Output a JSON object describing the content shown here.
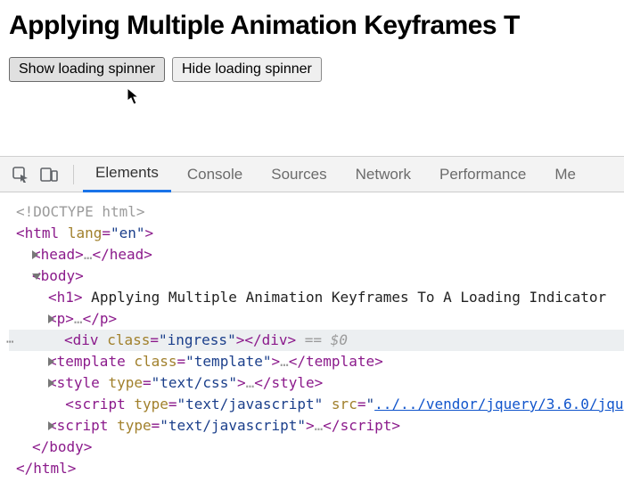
{
  "page": {
    "heading": "Applying Multiple Animation Keyframes T",
    "buttons": {
      "show": "Show loading spinner",
      "hide": "Hide loading spinner"
    }
  },
  "devtools": {
    "tabs": [
      "Elements",
      "Console",
      "Sources",
      "Network",
      "Performance",
      "Me"
    ],
    "selected_tab": 0,
    "tree": {
      "doctype": "<!DOCTYPE html>",
      "html_open": "html",
      "html_lang_attr": "lang",
      "html_lang_val": "\"en\"",
      "head": "head",
      "ellip": "…",
      "body": "body",
      "h1": "h1",
      "h1_text": " Applying Multiple Animation Keyframes To A Loading Indicator",
      "p": "p",
      "div": "div",
      "div_class_attr": "class",
      "div_class_val": "\"ingress\"",
      "eq0": " == $0",
      "template": "template",
      "template_class_attr": "class",
      "template_class_val": "\"template\"",
      "style": "style",
      "style_type_attr": "type",
      "style_type_val": "\"text/css\"",
      "script": "script",
      "script_type_attr": "type",
      "script_type_val": "\"text/javascript\"",
      "script_src_attr": "src",
      "script_src_val": "../../vendor/jquery/3.6.0/jqu",
      "html_close": "html"
    }
  }
}
